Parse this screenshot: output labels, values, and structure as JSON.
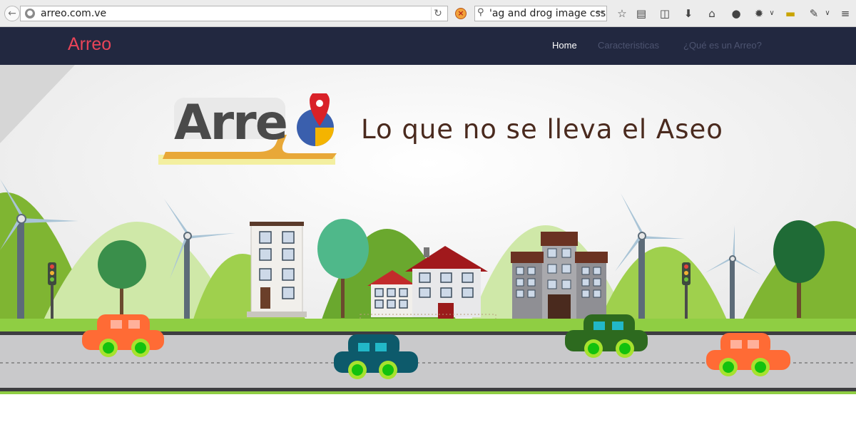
{
  "browser": {
    "url": "arreo.com.ve",
    "search_query": "'ag and drog image css",
    "icons": [
      "back-arrow-icon",
      "site-info-icon",
      "reload-icon",
      "noscript-icon",
      "search-icon",
      "search-go-icon",
      "bookmark-star-icon",
      "reading-list-icon",
      "pocket-icon",
      "download-icon",
      "home-icon",
      "chat-icon",
      "extension-icon",
      "chevron-down-icon",
      "note-icon",
      "eyedropper-icon"
    ]
  },
  "site": {
    "brand": "Arreo",
    "nav": [
      "Home",
      "Caracteristicas",
      "¿Qué es un Arreo?"
    ],
    "colors": {
      "navbar_bg": "#222840",
      "brand": "#e94458",
      "nav_active": "#ffffff",
      "nav_inactive": "#4d5470"
    }
  },
  "hero": {
    "logo_text": "Arre",
    "tagline": "Lo que no se lleva el Aseo"
  }
}
